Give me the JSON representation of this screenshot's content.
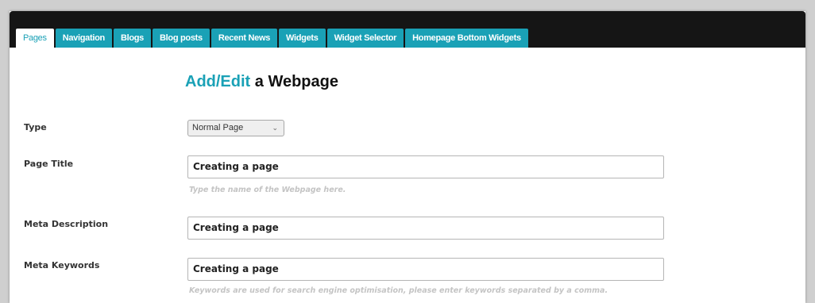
{
  "tabs": [
    {
      "label": "Pages",
      "active": true
    },
    {
      "label": "Navigation",
      "active": false
    },
    {
      "label": "Blogs",
      "active": false
    },
    {
      "label": "Blog posts",
      "active": false
    },
    {
      "label": "Recent News",
      "active": false
    },
    {
      "label": "Widgets",
      "active": false
    },
    {
      "label": "Widget Selector",
      "active": false
    },
    {
      "label": "Homepage Bottom Widgets",
      "active": false
    }
  ],
  "heading": {
    "accent": "Add/Edit",
    "rest": " a Webpage"
  },
  "form": {
    "type": {
      "label": "Type",
      "value": "Normal Page"
    },
    "page_title": {
      "label": "Page Title",
      "value": "Creating a page",
      "hint": "Type the name of the Webpage here."
    },
    "meta_description": {
      "label": "Meta Description",
      "value": "Creating a page"
    },
    "meta_keywords": {
      "label": "Meta Keywords",
      "value": "Creating a page",
      "hint": "Keywords are used for search engine optimisation, please enter keywords separated by a comma."
    }
  },
  "colors": {
    "accent": "#1aa1b6",
    "tabbar": "#151515"
  },
  "icons": {
    "select_chevron": "chevron-down-icon"
  }
}
